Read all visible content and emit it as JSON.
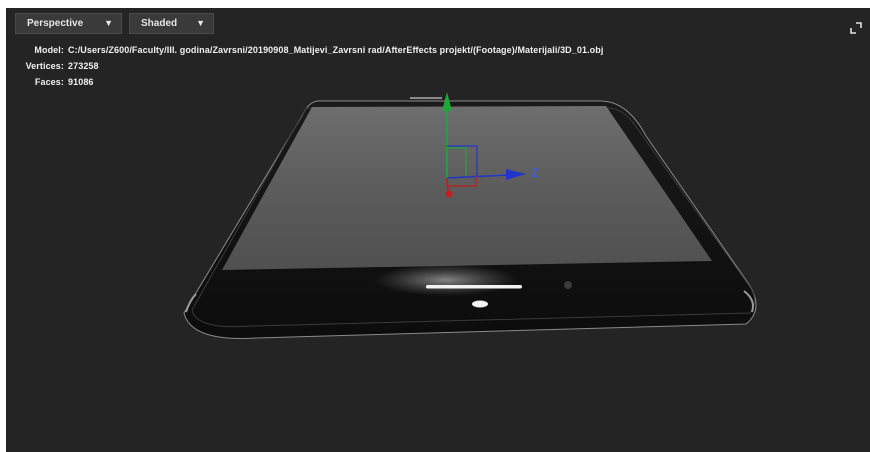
{
  "toolbar": {
    "view_mode": "Perspective",
    "shading_mode": "Shaded"
  },
  "model_info": {
    "model_label": "Model:",
    "model_path": "C:/Users/Z600/Faculty/III. godina/Zavrsni/20190908_Matijevi_Zavrsni rad/AfterEffects projekt/(Footage)/Materijali/3D_01.obj",
    "vertices_label": "Vertices:",
    "vertices_value": "273258",
    "faces_label": "Faces:",
    "faces_value": "91086"
  },
  "gizmo": {
    "z_label": "Z",
    "x_color": "#c02020",
    "y_color": "#1fa83a",
    "z_color": "#2135c9"
  },
  "icons": {
    "view_caret": "chevron-down-icon",
    "shade_caret": "chevron-down-icon",
    "expand": "expand-icon"
  },
  "colors": {
    "viewport_bg": "#242424",
    "dropdown_bg": "#3a3a3a",
    "text": "#f0f0f0"
  }
}
